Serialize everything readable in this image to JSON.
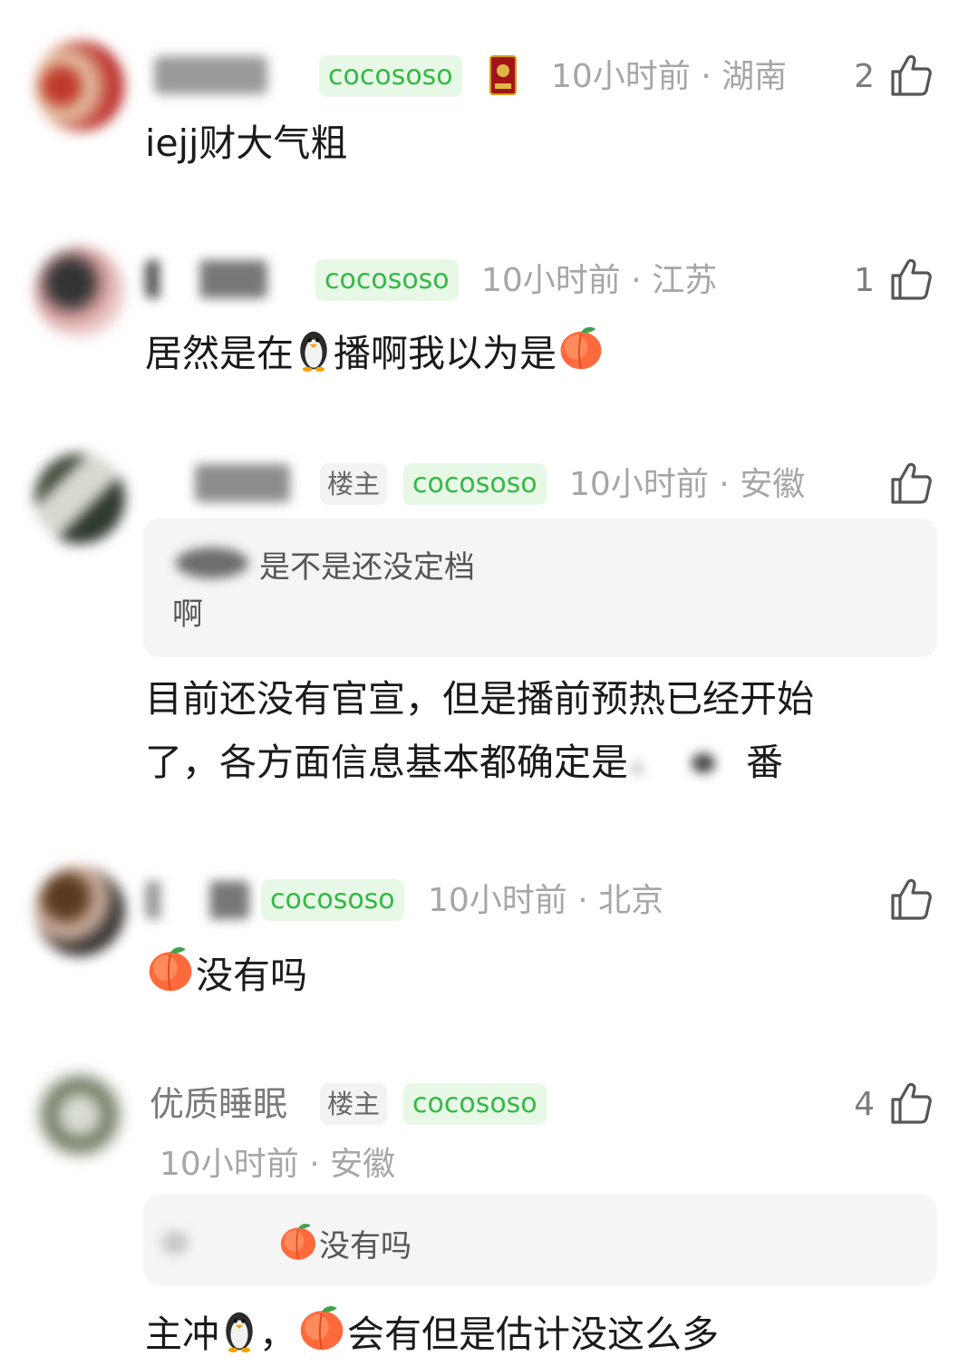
{
  "colors": {
    "accent_green": "#35b848",
    "badge_green_bg": "#e8f8e6",
    "meta_gray": "#a6a6a6"
  },
  "icons": {
    "like": "thumbs-up-icon",
    "penguin": "penguin-emoji",
    "peach": "peach-emoji",
    "medal": "red-medal-badge-icon"
  },
  "comments": [
    {
      "username": "",
      "badge": "cocososo",
      "time": "10小时前",
      "sep": "·",
      "region": "湖南",
      "likes": "2",
      "content": "iejj财大气粗"
    },
    {
      "username": "",
      "badge": "cocososo",
      "time": "10小时前",
      "sep": "·",
      "region": "江苏",
      "likes": "1",
      "content_before_penguin": "居然是在",
      "content_middle": "播啊我以为是"
    },
    {
      "username": "",
      "op_badge": "楼主",
      "badge": "cocososo",
      "time": "10小时前",
      "sep": "·",
      "region": "安徽",
      "likes": "",
      "quote_line1": "是不是还没定档",
      "quote_line2": "啊",
      "content_line1": "目前还没有官宣，但是播前预热已经开始",
      "content_line2": "了，各方面信息基本都确定是",
      "content_line2_end": "番"
    },
    {
      "username": "",
      "badge": "cocososo",
      "time": "10小时前",
      "sep": "·",
      "region": "北京",
      "likes": "",
      "content_after_peach": "没有吗"
    },
    {
      "username": "优质睡眠",
      "op_badge": "楼主",
      "badge": "cocososo",
      "time": "10小时前",
      "sep": "·",
      "region": "安徽",
      "likes": "4",
      "quote_after_peach": "没有吗",
      "content_start": "主冲",
      "content_comma": "，",
      "content_end": "会有但是估计没这么多"
    }
  ]
}
